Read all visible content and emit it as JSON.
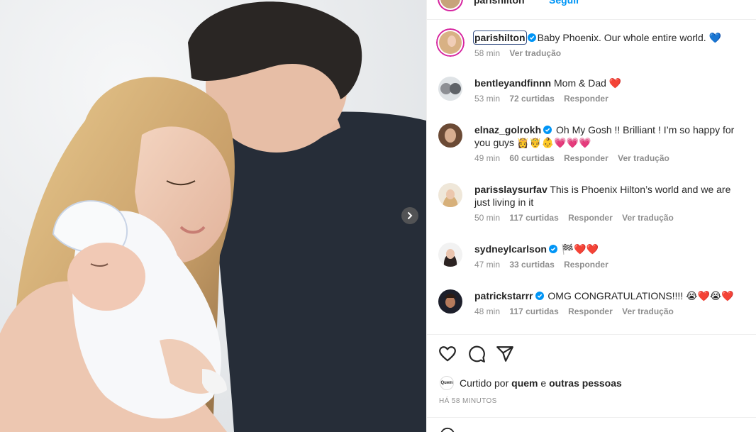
{
  "post_header": {
    "username": "parishilton",
    "follow_label": "Seguir"
  },
  "caption": {
    "username": "parishilton",
    "text": "Baby Phoenix. Our whole entire world. 💙",
    "time": "58 min",
    "translate": "Ver tradução"
  },
  "comments": [
    {
      "username": "bentleyandfinnn",
      "verified": false,
      "text": "Mom & Dad ❤️",
      "time": "53 min",
      "likes": "72 curtidas",
      "reply": "Responder",
      "translate": ""
    },
    {
      "username": "elnaz_golrokh",
      "verified": true,
      "text": "Oh My Gosh !! Brilliant ! I’m so happy for you guys 👸🤴👶💗💗💗",
      "time": "49 min",
      "likes": "60 curtidas",
      "reply": "Responder",
      "translate": "Ver tradução"
    },
    {
      "username": "parisslaysurfav",
      "verified": false,
      "text": "This is Phoenix Hilton’s world and we are just living in it",
      "time": "50 min",
      "likes": "117 curtidas",
      "reply": "Responder",
      "translate": "Ver tradução"
    },
    {
      "username": "sydneylcarlson",
      "verified": true,
      "text": "🏁❤️❤️",
      "time": "47 min",
      "likes": "33 curtidas",
      "reply": "Responder",
      "translate": ""
    },
    {
      "username": "patrickstarrr",
      "verified": true,
      "text": "OMG CONGRATULATIONS!!!! 😭❤️😭❤️",
      "time": "48 min",
      "likes": "117 curtidas",
      "reply": "Responder",
      "translate": "Ver tradução"
    }
  ],
  "likes_line": {
    "avatar_text": "Quem",
    "prefix": "Curtido por",
    "who": "quem",
    "joiner": "e",
    "others": "outras pessoas"
  },
  "time_ago": "HÁ 58 MINUTOS",
  "icons": {
    "like": "heart-icon",
    "comment": "comment-icon",
    "share": "share-icon",
    "next": "chevron-right-icon",
    "verified": "verified-badge-icon"
  },
  "colors": {
    "link": "#0095f6",
    "verified": "#0095f6",
    "muted": "#8e8e8e"
  }
}
